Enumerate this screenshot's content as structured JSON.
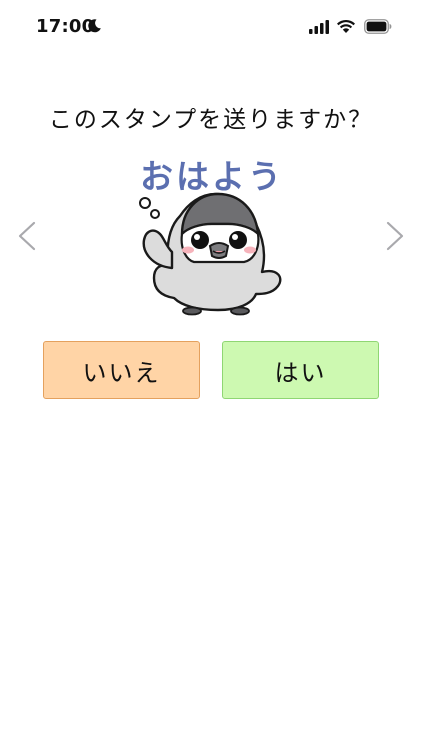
{
  "status_bar": {
    "time": "17:00",
    "icons": [
      "moon-icon",
      "cellular-signal-icon",
      "wifi-icon",
      "battery-icon"
    ]
  },
  "dialog": {
    "prompt": "このスタンプを送りますか？",
    "sticker": {
      "text": "おはよう",
      "text_color": "#5b6fb0",
      "character": "penguin"
    },
    "no_button_label": "いいえ",
    "yes_button_label": "はい",
    "colors": {
      "no_button_bg": "#ffd4a6",
      "no_button_border": "#e4a15e",
      "yes_button_bg": "#cdf9b1",
      "yes_button_border": "#8fd673"
    }
  },
  "navigation": {
    "previous_icon": "chevron-left-icon",
    "next_icon": "chevron-right-icon"
  }
}
